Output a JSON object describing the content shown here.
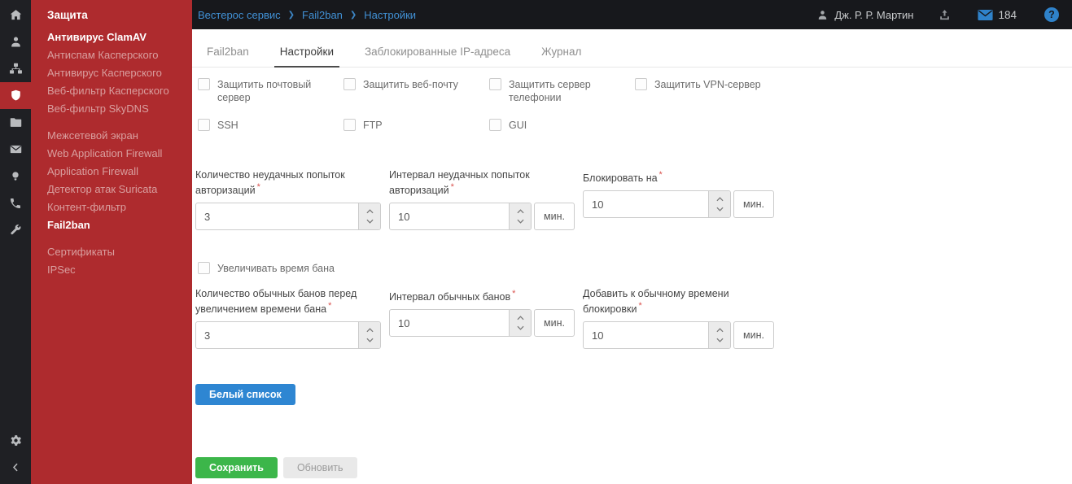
{
  "topbar": {
    "breadcrumb": {
      "separator": "❯",
      "items": [
        {
          "label": "Вестерос сервис"
        },
        {
          "label": "Fail2ban"
        },
        {
          "label": "Настройки"
        }
      ]
    },
    "user_name": "Дж. Р. Р. Мартин",
    "mail_count": "184",
    "help_label": "?"
  },
  "sidebar": {
    "header": "Защита",
    "group1": [
      {
        "label": "Антивирус ClamAV"
      },
      {
        "label": "Антиспам Касперского"
      },
      {
        "label": "Антивирус Касперского"
      },
      {
        "label": "Веб-фильтр Касперского"
      },
      {
        "label": "Веб-фильтр SkyDNS"
      }
    ],
    "group2": [
      {
        "label": "Межсетевой экран"
      },
      {
        "label": "Web Application Firewall"
      },
      {
        "label": "Application Firewall"
      },
      {
        "label": "Детектор атак Suricata"
      },
      {
        "label": "Контент-фильтр"
      },
      {
        "label": "Fail2ban"
      }
    ],
    "group3": [
      {
        "label": "Сертификаты"
      },
      {
        "label": "IPSec"
      }
    ]
  },
  "tabs": [
    {
      "label": "Fail2ban"
    },
    {
      "label": "Настройки",
      "active": true
    },
    {
      "label": "Заблокированные IP-адреса"
    },
    {
      "label": "Журнал"
    }
  ],
  "protect": {
    "row1": [
      {
        "label": "Защитить почтовый сервер",
        "checked": false
      },
      {
        "label": "Защитить веб-почту",
        "checked": false
      },
      {
        "label": "Защитить сервер телефонии",
        "checked": false
      },
      {
        "label": "Защитить VPN-сервер",
        "checked": false
      }
    ],
    "row2": [
      {
        "label": "SSH",
        "checked": false
      },
      {
        "label": "FTP",
        "checked": false
      },
      {
        "label": "GUI",
        "checked": false
      }
    ]
  },
  "form": {
    "attempts": {
      "label": "Количество неудачных попыток авторизаций",
      "required_mark": "*",
      "value": "3"
    },
    "attempts_interval": {
      "label": "Интервал неудачных попыток авторизаций",
      "required_mark": "*",
      "value": "10",
      "unit": "мин."
    },
    "block_for": {
      "label": "Блокировать на",
      "required_mark": "*",
      "value": "10",
      "unit": "мин."
    },
    "increase_ban": {
      "label": "Увеличивать время бана",
      "checked": false
    },
    "bans_before": {
      "label": "Количество обычных банов перед увеличением времени бана",
      "required_mark": "*",
      "value": "3"
    },
    "bans_interval": {
      "label": "Интервал обычных банов",
      "required_mark": "*",
      "value": "10",
      "unit": "мин."
    },
    "add_time": {
      "label": "Добавить к обычному времени блокировки",
      "required_mark": "*",
      "value": "10",
      "unit": "мин."
    }
  },
  "buttons": {
    "whitelist": "Белый список",
    "save": "Сохранить",
    "refresh": "Обновить"
  },
  "colors": {
    "sidebar_red": "#ae2b2e",
    "topbar_dark": "#17181c",
    "accent_blue": "#2f82ca",
    "button_blue": "#2e86d2",
    "button_green": "#3cb64a"
  }
}
